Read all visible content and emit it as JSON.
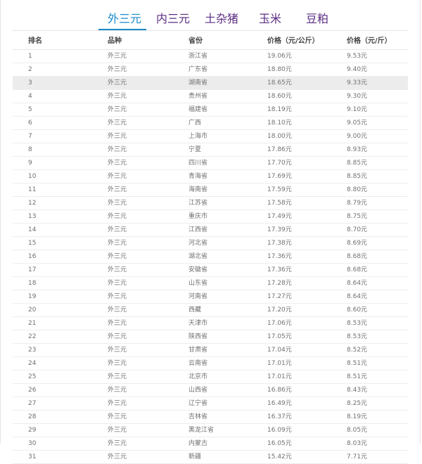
{
  "tabs": [
    {
      "label": "外三元",
      "active": true
    },
    {
      "label": "内三元",
      "active": false
    },
    {
      "label": "土杂猪",
      "active": false
    },
    {
      "label": "玉米",
      "active": false
    },
    {
      "label": "豆粕",
      "active": false
    }
  ],
  "colors": {
    "active_tab": "#1a8ac9",
    "inactive_tab": "#5a2d82",
    "row_highlight": "#ececec"
  },
  "table": {
    "headers": [
      "排名",
      "品种",
      "省份",
      "价格（元/公斤）",
      "价格（元/斤）"
    ],
    "highlighted_rank": "3",
    "rows": [
      [
        "1",
        "外三元",
        "浙江省",
        "19.06元",
        "9.53元"
      ],
      [
        "2",
        "外三元",
        "广东省",
        "18.80元",
        "9.40元"
      ],
      [
        "3",
        "外三元",
        "湖南省",
        "18.65元",
        "9.33元"
      ],
      [
        "4",
        "外三元",
        "贵州省",
        "18.60元",
        "9.30元"
      ],
      [
        "5",
        "外三元",
        "福建省",
        "18.19元",
        "9.10元"
      ],
      [
        "6",
        "外三元",
        "广西",
        "18.10元",
        "9.05元"
      ],
      [
        "7",
        "外三元",
        "上海市",
        "18.00元",
        "9.00元"
      ],
      [
        "8",
        "外三元",
        "宁夏",
        "17.86元",
        "8.93元"
      ],
      [
        "9",
        "外三元",
        "四川省",
        "17.70元",
        "8.85元"
      ],
      [
        "10",
        "外三元",
        "青海省",
        "17.69元",
        "8.85元"
      ],
      [
        "11",
        "外三元",
        "海南省",
        "17.59元",
        "8.80元"
      ],
      [
        "12",
        "外三元",
        "江苏省",
        "17.58元",
        "8.79元"
      ],
      [
        "13",
        "外三元",
        "重庆市",
        "17.49元",
        "8.75元"
      ],
      [
        "14",
        "外三元",
        "江西省",
        "17.39元",
        "8.70元"
      ],
      [
        "15",
        "外三元",
        "河北省",
        "17.38元",
        "8.69元"
      ],
      [
        "16",
        "外三元",
        "湖北省",
        "17.36元",
        "8.68元"
      ],
      [
        "17",
        "外三元",
        "安徽省",
        "17.36元",
        "8.68元"
      ],
      [
        "18",
        "外三元",
        "山东省",
        "17.28元",
        "8.64元"
      ],
      [
        "19",
        "外三元",
        "河南省",
        "17.27元",
        "8.64元"
      ],
      [
        "20",
        "外三元",
        "西藏",
        "17.20元",
        "8.60元"
      ],
      [
        "21",
        "外三元",
        "天津市",
        "17.06元",
        "8.53元"
      ],
      [
        "22",
        "外三元",
        "陕西省",
        "17.05元",
        "8.53元"
      ],
      [
        "23",
        "外三元",
        "甘肃省",
        "17.04元",
        "8.52元"
      ],
      [
        "24",
        "外三元",
        "云南省",
        "17.01元",
        "8.51元"
      ],
      [
        "25",
        "外三元",
        "北京市",
        "17.01元",
        "8.51元"
      ],
      [
        "26",
        "外三元",
        "山西省",
        "16.86元",
        "8.43元"
      ],
      [
        "27",
        "外三元",
        "辽宁省",
        "16.49元",
        "8.25元"
      ],
      [
        "28",
        "外三元",
        "吉林省",
        "16.37元",
        "8.19元"
      ],
      [
        "29",
        "外三元",
        "黑龙江省",
        "16.09元",
        "8.05元"
      ],
      [
        "30",
        "外三元",
        "内蒙古",
        "16.05元",
        "8.03元"
      ],
      [
        "31",
        "外三元",
        "新疆",
        "15.42元",
        "7.71元"
      ]
    ]
  }
}
